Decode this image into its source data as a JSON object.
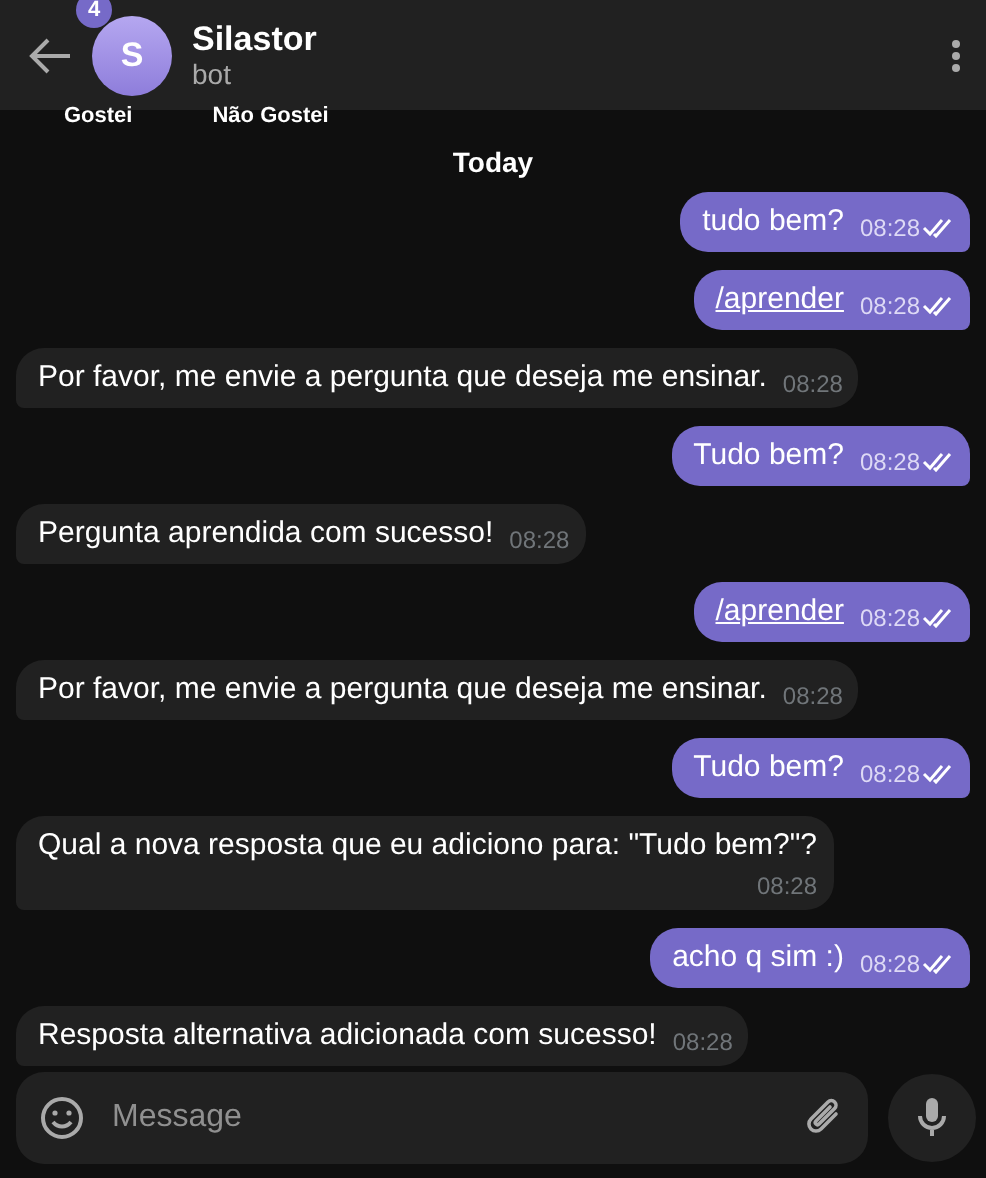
{
  "header": {
    "unread_badge": "4",
    "avatar_letter": "S",
    "title": "Silastor",
    "subtitle": "bot"
  },
  "keyboard_buttons": [
    "Gostei",
    "Não Gostei"
  ],
  "date_label": "Today",
  "messages": [
    {
      "kind": "out",
      "text": "tudo bem?",
      "time": "08:28",
      "command": false,
      "read": true
    },
    {
      "kind": "out",
      "text": "/aprender",
      "time": "08:28",
      "command": true,
      "read": true
    },
    {
      "kind": "in",
      "text": "Por favor, me envie a pergunta que deseja me ensinar.",
      "time": "08:28",
      "command": false
    },
    {
      "kind": "out",
      "text": "Tudo bem?",
      "time": "08:28",
      "command": false,
      "read": true
    },
    {
      "kind": "in",
      "text": "Pergunta aprendida com sucesso!",
      "time": "08:28",
      "command": false
    },
    {
      "kind": "out",
      "text": "/aprender",
      "time": "08:28",
      "command": true,
      "read": true
    },
    {
      "kind": "in",
      "text": "Por favor, me envie a pergunta que deseja me ensinar.",
      "time": "08:28",
      "command": false
    },
    {
      "kind": "out",
      "text": "Tudo bem?",
      "time": "08:28",
      "command": false,
      "read": true
    },
    {
      "kind": "in",
      "text": "Qual a nova resposta que eu adiciono para: \"Tudo bem?\"?",
      "time": "08:28",
      "command": false,
      "wrap_time": true
    },
    {
      "kind": "out",
      "text": "acho q sim :)",
      "time": "08:28",
      "command": false,
      "read": true
    },
    {
      "kind": "in",
      "text": "Resposta alternativa adicionada com sucesso!",
      "time": "08:28",
      "command": false
    }
  ],
  "composer": {
    "placeholder": "Message"
  }
}
